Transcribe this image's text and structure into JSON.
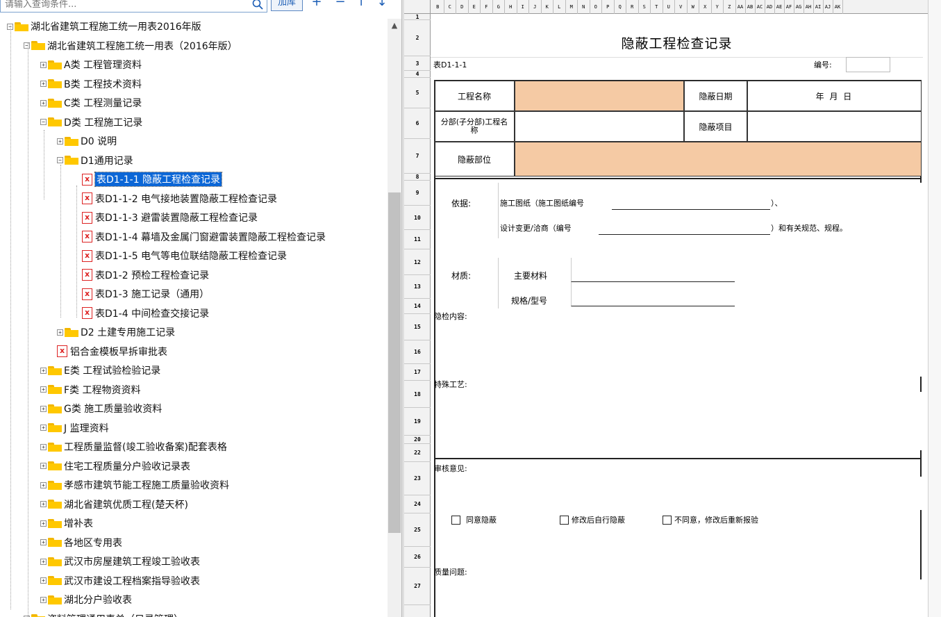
{
  "search": {
    "placeholder": "请输入查询条件..."
  },
  "toolbar": {
    "add_library": "加库",
    "add": "+",
    "remove": "−",
    "move_up": "↑",
    "move_down": "↓"
  },
  "tree": [
    {
      "label": "湖北省建筑工程施工统一用表2016年版",
      "level": 0,
      "type": "folder",
      "expanded": true
    },
    {
      "label": "湖北省建筑工程施工统一用表（2016年版）",
      "level": 1,
      "type": "folder",
      "expanded": true
    },
    {
      "label": "A类 工程管理资料",
      "level": 2,
      "type": "folder",
      "expanded": false
    },
    {
      "label": "B类 工程技术资料",
      "level": 2,
      "type": "folder",
      "expanded": false
    },
    {
      "label": "C类 工程测量记录",
      "level": 2,
      "type": "folder",
      "expanded": false
    },
    {
      "label": "D类 工程施工记录",
      "level": 2,
      "type": "folder",
      "expanded": true
    },
    {
      "label": "D0 说明",
      "level": 3,
      "type": "folder",
      "expanded": false
    },
    {
      "label": "D1通用记录",
      "level": 3,
      "type": "folder",
      "expanded": true
    },
    {
      "label": "表D1-1-1 隐蔽工程检查记录",
      "level": 4,
      "type": "file",
      "selected": true
    },
    {
      "label": "表D1-1-2 电气接地装置隐蔽工程检查记录",
      "level": 4,
      "type": "file"
    },
    {
      "label": "表D1-1-3 避雷装置隐蔽工程检查记录",
      "level": 4,
      "type": "file"
    },
    {
      "label": "表D1-1-4 幕墙及金属门窗避雷装置隐蔽工程检查记录",
      "level": 4,
      "type": "file"
    },
    {
      "label": "表D1-1-5 电气等电位联结隐蔽工程检查记录",
      "level": 4,
      "type": "file"
    },
    {
      "label": "表D1-2 预检工程检查记录",
      "level": 4,
      "type": "file"
    },
    {
      "label": "表D1-3 施工记录（通用）",
      "level": 4,
      "type": "file"
    },
    {
      "label": "表D1-4 中间检查交接记录",
      "level": 4,
      "type": "file"
    },
    {
      "label": "D2 土建专用施工记录",
      "level": 3,
      "type": "folder",
      "expanded": false
    },
    {
      "label": "铝合金模板早拆审批表",
      "level": 3,
      "type": "file"
    },
    {
      "label": "E类 工程试验检验记录",
      "level": 2,
      "type": "folder",
      "expanded": false
    },
    {
      "label": "F类 工程物资资料",
      "level": 2,
      "type": "folder",
      "expanded": false
    },
    {
      "label": "G类 施工质量验收资料",
      "level": 2,
      "type": "folder",
      "expanded": false
    },
    {
      "label": "J 监理资料",
      "level": 2,
      "type": "folder",
      "expanded": false
    },
    {
      "label": "工程质量监督(竣工验收备案)配套表格",
      "level": 2,
      "type": "folder",
      "expanded": false
    },
    {
      "label": "住宅工程质量分户验收记录表",
      "level": 2,
      "type": "folder",
      "expanded": false
    },
    {
      "label": "孝感市建筑节能工程施工质量验收资料",
      "level": 2,
      "type": "folder",
      "expanded": false
    },
    {
      "label": "湖北省建筑优质工程(楚天杯)",
      "level": 2,
      "type": "folder",
      "expanded": false
    },
    {
      "label": "增补表",
      "level": 2,
      "type": "folder",
      "expanded": false
    },
    {
      "label": "各地区专用表",
      "level": 2,
      "type": "folder",
      "expanded": false
    },
    {
      "label": "武汉市房屋建筑工程竣工验收表",
      "level": 2,
      "type": "folder",
      "expanded": false
    },
    {
      "label": "武汉市建设工程档案指导验收表",
      "level": 2,
      "type": "folder",
      "expanded": false
    },
    {
      "label": "湖北分户验收表",
      "level": 2,
      "type": "folder",
      "expanded": false
    },
    {
      "label": "资料管理通用表单（目录管理）",
      "level": 1,
      "type": "folder",
      "expanded": false
    }
  ],
  "sheet": {
    "columns": [
      "B",
      "C",
      "D",
      "E",
      "F",
      "G",
      "H",
      "I",
      "J",
      "K",
      "L",
      "M",
      "N",
      "O",
      "P",
      "Q",
      "R",
      "S",
      "T",
      "U",
      "V",
      "W",
      "X",
      "Y",
      "Z",
      "AA",
      "AB",
      "AC",
      "AD",
      "AE",
      "AF",
      "AG",
      "AH",
      "AI",
      "AJ",
      "AK"
    ],
    "row_numbers": [
      "1",
      "2",
      "3",
      "4",
      "5",
      "6",
      "7",
      "8",
      "9",
      "10",
      "11",
      "12",
      "13",
      "14",
      "15",
      "16",
      "17",
      "18",
      "19",
      "20",
      "22",
      "23",
      "24",
      "25",
      "26",
      "27"
    ],
    "title": "隐蔽工程检查记录",
    "form_code": "表D1-1-1",
    "serial_label": "编号:",
    "project_name_label": "工程名称",
    "hidden_date_label": "隐蔽日期",
    "date_placeholder": "年   月   日",
    "subproject_label": "分部(子分部)工程名称",
    "hidden_item_label": "隐蔽项目",
    "hidden_location_label": "隐蔽部位",
    "basis_label": "依据:",
    "drawing_label": "施工图纸（施工图纸编号",
    "drawing_suffix": "）、",
    "change_label": "设计变更/洽商（编号",
    "change_suffix": "）和有关规范、规程。",
    "material_label": "材质:",
    "main_material_label": "主要材料",
    "spec_label": "规格/型号",
    "content_label": "隐检内容:",
    "special_process_label": "特殊工艺:",
    "review_label": "审核意见:",
    "option_agree": "同意隐蔽",
    "option_modify": "修改后自行隐蔽",
    "option_reject": "不同意，修改后重新报验",
    "quality_issue_label": "质量问题:"
  }
}
